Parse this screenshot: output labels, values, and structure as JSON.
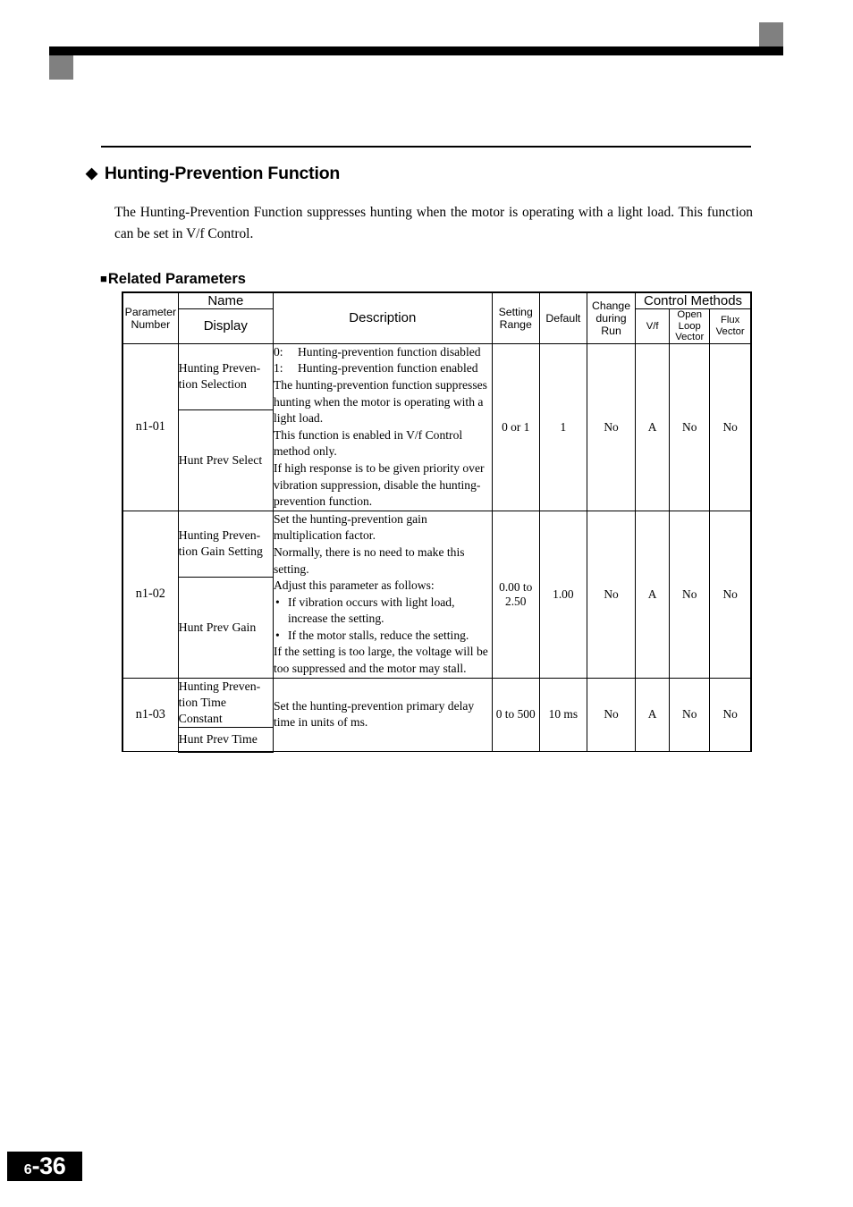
{
  "header_band": {
    "accent_color": "#808080",
    "bar_color": "#000000"
  },
  "section": {
    "bullet_glyph": "◆",
    "title": "Hunting-Prevention Function",
    "intro": "The Hunting-Prevention Function suppresses hunting when the motor is operating with a light load. This function can be set in V/f Control.",
    "subsection_bullet_glyph": "■",
    "subsection_title": "Related Parameters"
  },
  "table": {
    "headers": {
      "parameter_number": "Parameter\nNumber",
      "name": "Name",
      "display": "Display",
      "description": "Description",
      "setting_range": "Setting\nRange",
      "default": "Default",
      "change_during_run": "Change\nduring\nRun",
      "control_methods": "Control Methods",
      "vf": "V/f",
      "open_loop_vector": "Open\nLoop\nVector",
      "flux_vector": "Flux\nVector"
    },
    "rows": [
      {
        "parameter_number": "n1-01",
        "name": "Hunting Preven-\ntion Selection",
        "display": "Hunt Prev Select",
        "description_options": [
          {
            "key": "0:",
            "text": "Hunting-prevention function disabled"
          },
          {
            "key": "1:",
            "text": "Hunting-prevention function enabled"
          }
        ],
        "description_paragraphs": [
          "The hunting-prevention function suppresses hunting when the motor is operating with a light load.",
          "This function is enabled in V/f Control method only.",
          "If high response is to be given priority over vibration suppression, disable the hunting-prevention function."
        ],
        "setting_range": "0 or 1",
        "default": "1",
        "change_during_run": "No",
        "vf": "A",
        "open_loop_vector": "No",
        "flux_vector": "No"
      },
      {
        "parameter_number": "n1-02",
        "name": "Hunting Preven-\ntion Gain Setting",
        "display": "Hunt Prev Gain",
        "description_paragraphs": [
          "Set the hunting-prevention gain multiplication factor.",
          "Normally, there is no need to make this setting.",
          "Adjust this parameter as follows:"
        ],
        "description_bullets": [
          "If vibration occurs with light load, increase the setting.",
          "If the motor stalls, reduce the setting."
        ],
        "description_tail": [
          "If the setting is too large, the voltage will be too suppressed and the motor may stall."
        ],
        "setting_range": "0.00 to\n2.50",
        "default": "1.00",
        "change_during_run": "No",
        "vf": "A",
        "open_loop_vector": "No",
        "flux_vector": "No"
      },
      {
        "parameter_number": "n1-03",
        "name": "Hunting Preven-\ntion Time Constant",
        "display": "Hunt Prev Time",
        "description_paragraphs": [
          "Set the hunting-prevention primary delay time in units of ms."
        ],
        "setting_range": "0 to 500",
        "default": "10 ms",
        "change_during_run": "No",
        "vf": "A",
        "open_loop_vector": "No",
        "flux_vector": "No"
      }
    ]
  },
  "footer": {
    "chapter": "6",
    "separator": "-",
    "page": "36"
  }
}
